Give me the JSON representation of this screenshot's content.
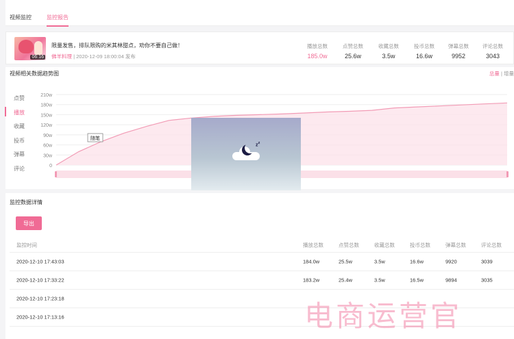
{
  "tabs": [
    "视频监控",
    "监控报告"
  ],
  "video": {
    "duration": "06:16",
    "title": "限量发售，排队限购的米其林甜点，劝你不要自己做！",
    "uploader": "佛羊料理",
    "published": "| 2020-12-09 18:00:04 发布",
    "stats": [
      {
        "label": "播放总数",
        "value": "185.0w",
        "highlight": true
      },
      {
        "label": "点赞总数",
        "value": "25.6w"
      },
      {
        "label": "收藏总数",
        "value": "3.5w"
      },
      {
        "label": "投币总数",
        "value": "16.6w"
      },
      {
        "label": "弹幕总数",
        "value": "9952"
      },
      {
        "label": "评论总数",
        "value": "3043"
      }
    ]
  },
  "trend": {
    "title": "视频相关数据趋势图",
    "toggle_total": "总量",
    "toggle_increment": "增量",
    "metrics": [
      "点赞",
      "播放",
      "收藏",
      "投币",
      "弹幕",
      "评论"
    ],
    "active_metric": "播放",
    "annotation": "随笔"
  },
  "chart_data": {
    "type": "area",
    "yticks": [
      "0",
      "30w",
      "60w",
      "90w",
      "120w",
      "150w",
      "180w",
      "210w"
    ],
    "ylim": [
      0,
      210
    ],
    "series": [
      {
        "values": [
          0,
          40,
          70,
          95,
          115,
          133,
          140,
          145,
          148,
          150,
          152,
          155,
          158,
          160,
          163,
          170,
          173,
          176,
          179,
          182,
          185
        ]
      }
    ],
    "grid": true,
    "colors": {
      "line": "#f29bb5",
      "fill": "#fde3eb"
    }
  },
  "details": {
    "title": "监控数据详情",
    "export_label": "导出",
    "columns": [
      "监控时间",
      "播放总数",
      "点赞总数",
      "收藏总数",
      "投币总数",
      "弹幕总数",
      "评论总数"
    ],
    "rows": [
      [
        "2020-12-10 17:43:03",
        "184.0w",
        "25.5w",
        "3.5w",
        "16.6w",
        "9920",
        "3039"
      ],
      [
        "2020-12-10 17:33:22",
        "183.2w",
        "25.4w",
        "3.5w",
        "16.5w",
        "9894",
        "3035"
      ],
      [
        "2020-12-10 17:23:18",
        "",
        "",
        "",
        "",
        "",
        ""
      ],
      [
        "2020-12-10 17:13:16",
        "",
        "",
        "",
        "",
        "",
        ""
      ]
    ]
  },
  "watermark": "电商运营官",
  "colors": {
    "accent": "#f06b95"
  }
}
